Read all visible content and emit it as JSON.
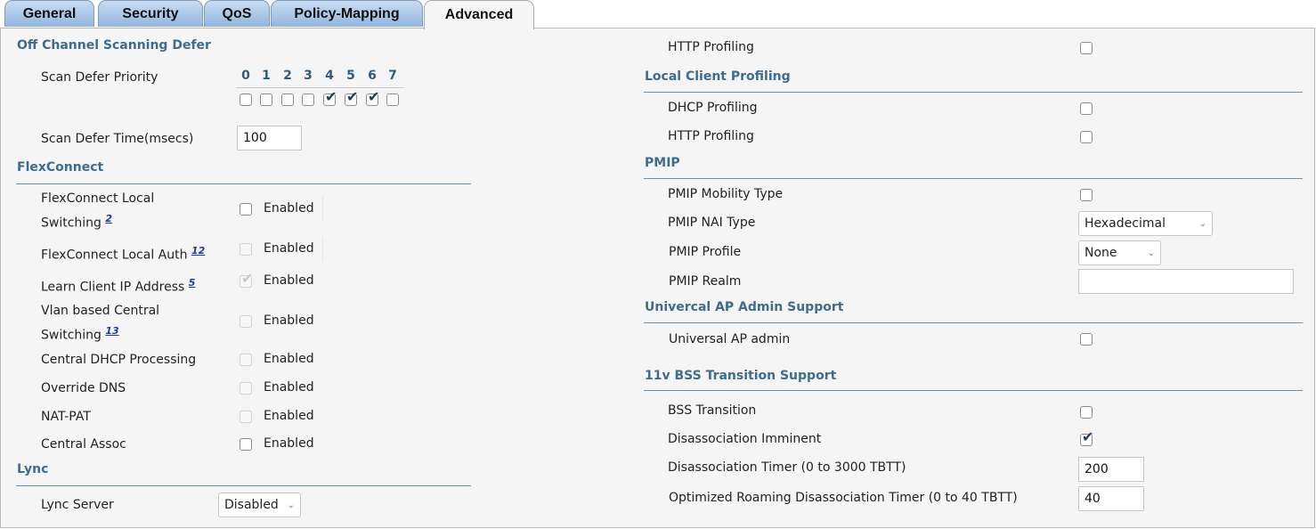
{
  "tabs": [
    "General",
    "Security",
    "QoS",
    "Policy-Mapping",
    "Advanced"
  ],
  "active_tab": "Advanced",
  "left": {
    "off_channel": {
      "title": "Off Channel Scanning Defer",
      "priority_label": "Scan Defer Priority",
      "priority_numbers": [
        "0",
        "1",
        "2",
        "3",
        "4",
        "5",
        "6",
        "7"
      ],
      "priority_checked": [
        false,
        false,
        false,
        false,
        true,
        true,
        true,
        false
      ],
      "time_label": "Scan Defer Time(msecs)",
      "time_value": "100"
    },
    "flexconnect": {
      "title": "FlexConnect",
      "enabled_text": "Enabled",
      "rows": [
        {
          "label_line1": "FlexConnect Local",
          "label_line2": "Switching",
          "footnote": "2",
          "checked": false,
          "disabled": false
        },
        {
          "label_line1": "FlexConnect Local Auth",
          "label_line2": "",
          "footnote": "12",
          "checked": false,
          "disabled": true
        },
        {
          "label_line1": "Learn Client IP Address",
          "label_line2": "",
          "footnote": "5",
          "checked": true,
          "disabled": true
        },
        {
          "label_line1": "Vlan based Central",
          "label_line2": "Switching",
          "footnote": "13",
          "checked": false,
          "disabled": true
        },
        {
          "label_line1": "Central DHCP Processing",
          "label_line2": "",
          "footnote": "",
          "checked": false,
          "disabled": true
        },
        {
          "label_line1": "Override DNS",
          "label_line2": "",
          "footnote": "",
          "checked": false,
          "disabled": true
        },
        {
          "label_line1": "NAT-PAT",
          "label_line2": "",
          "footnote": "",
          "checked": false,
          "disabled": true
        },
        {
          "label_line1": "Central Assoc",
          "label_line2": "",
          "footnote": "",
          "checked": false,
          "disabled": false
        }
      ]
    },
    "lync": {
      "title": "Lync",
      "server_label": "Lync Server",
      "server_value": "Disabled"
    }
  },
  "right": {
    "http_profiling_label": "HTTP Profiling",
    "local_client": {
      "title": "Local Client Profiling",
      "dhcp_label": "DHCP Profiling",
      "http_label": "HTTP Profiling"
    },
    "pmip": {
      "title": "PMIP",
      "mobility_label": "PMIP Mobility Type",
      "nai_label": "PMIP NAI Type",
      "nai_value": "Hexadecimal",
      "profile_label": "PMIP Profile",
      "profile_value": "None",
      "realm_label": "PMIP Realm",
      "realm_value": ""
    },
    "universal": {
      "title": "Univercal AP Admin Support",
      "label": "Universal AP admin"
    },
    "bss": {
      "title": "11v BSS Transition Support",
      "transition_label": "BSS Transition",
      "transition_checked": false,
      "imminent_label": "Disassociation Imminent",
      "imminent_checked": true,
      "timer_label": "Disassociation Timer (0 to 3000 TBTT)",
      "timer_value": "200",
      "roam_label": "Optimized Roaming Disassociation Timer (0 to 40 TBTT)",
      "roam_value": "40"
    }
  },
  "icons": {
    "checkmark": "✔",
    "chevron": "⌄"
  }
}
